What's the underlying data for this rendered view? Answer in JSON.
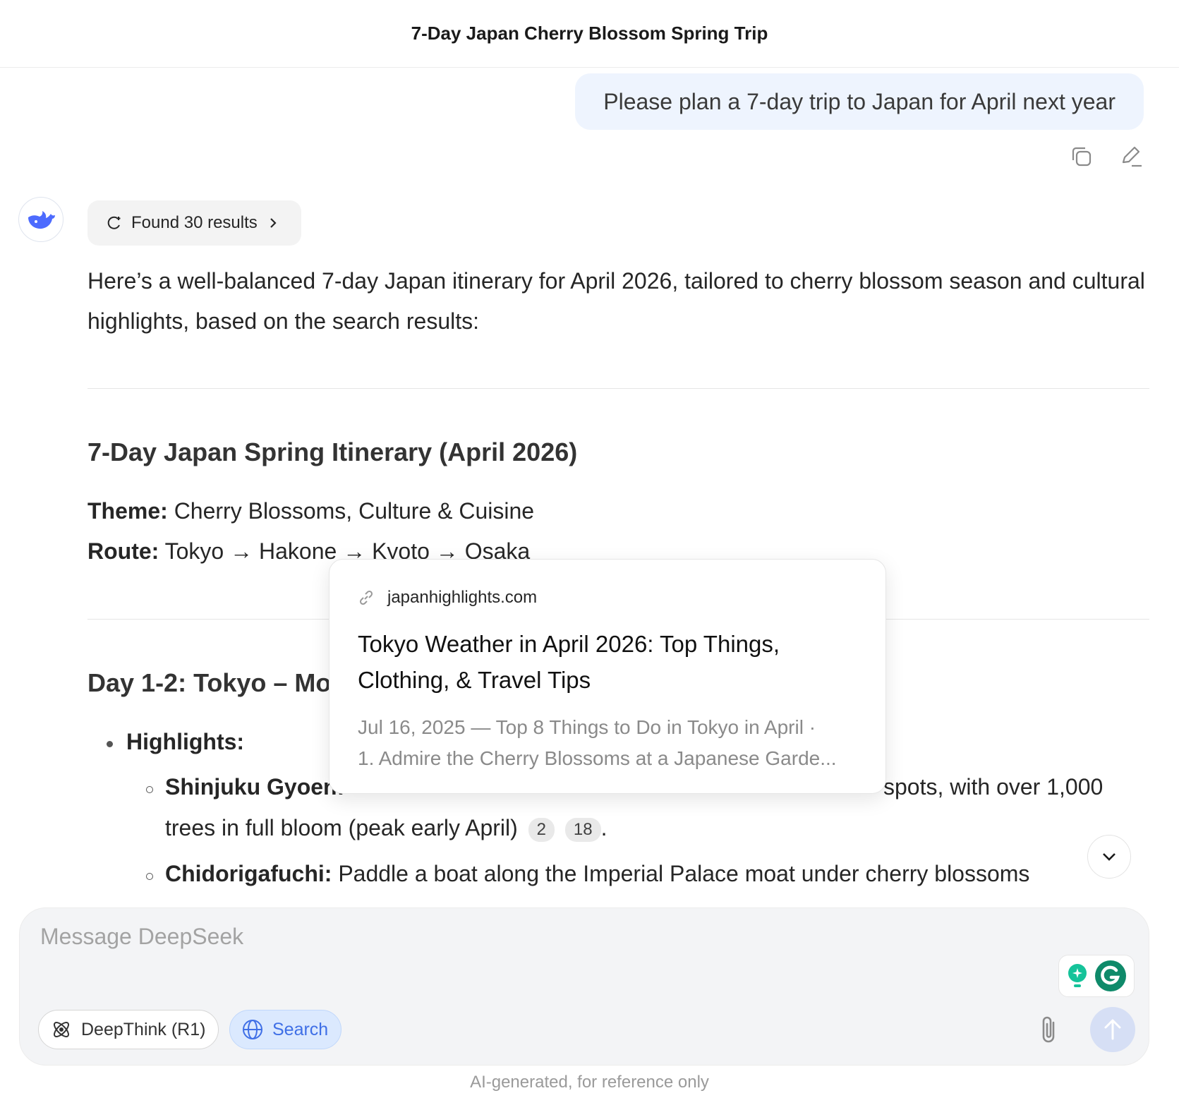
{
  "header": {
    "title": "7-Day Japan Cherry Blossom Spring Trip"
  },
  "user_message": {
    "text": "Please plan a 7-day trip to Japan for April next year"
  },
  "search_chip": {
    "label": "Found 30 results"
  },
  "response": {
    "intro": "Here’s a well-balanced 7-day Japan itinerary for April 2026, tailored to cherry blossom season and cultural highlights, based on the search results:",
    "heading": "7-Day Japan Spring Itinerary (April 2026)",
    "theme_label": "Theme:",
    "theme_value": "Cherry Blossoms, Culture & Cuisine",
    "route_label": "Route:",
    "route_value": "Tokyo → Hakone → Kyoto → Osaka",
    "day_heading": "Day 1-2: Tokyo – Mo",
    "highlights_label": "Highlights:",
    "items": [
      {
        "name": "Shinjuku Gyoen:",
        "text_line1_tail": "spots, with over 1,000",
        "text_line2": "trees in full bloom (peak early April)",
        "refs": [
          "2",
          "18"
        ]
      },
      {
        "name": "Chidorigafuchi:",
        "text": "Paddle a boat along the Imperial Palace moat under cherry blossoms"
      }
    ]
  },
  "popover": {
    "domain": "japanhighlights.com",
    "title_line1": "Tokyo Weather in April 2026: Top Things,",
    "title_line2": "Clothing, & Travel Tips",
    "snippet_line1": "Jul 16, 2025 — Top 8 Things to Do in Tokyo in April ·",
    "snippet_line2": "1. Admire the Cherry Blossoms at a Japanese Garde..."
  },
  "composer": {
    "placeholder": "Message DeepSeek",
    "deepthink_label": "DeepThink (R1)",
    "search_label": "Search"
  },
  "disclaimer": "AI-generated, for reference only",
  "colors": {
    "accent": "#4d6bfe",
    "user_bubble": "#eef4fe",
    "search_active": "#dbe9fe"
  }
}
